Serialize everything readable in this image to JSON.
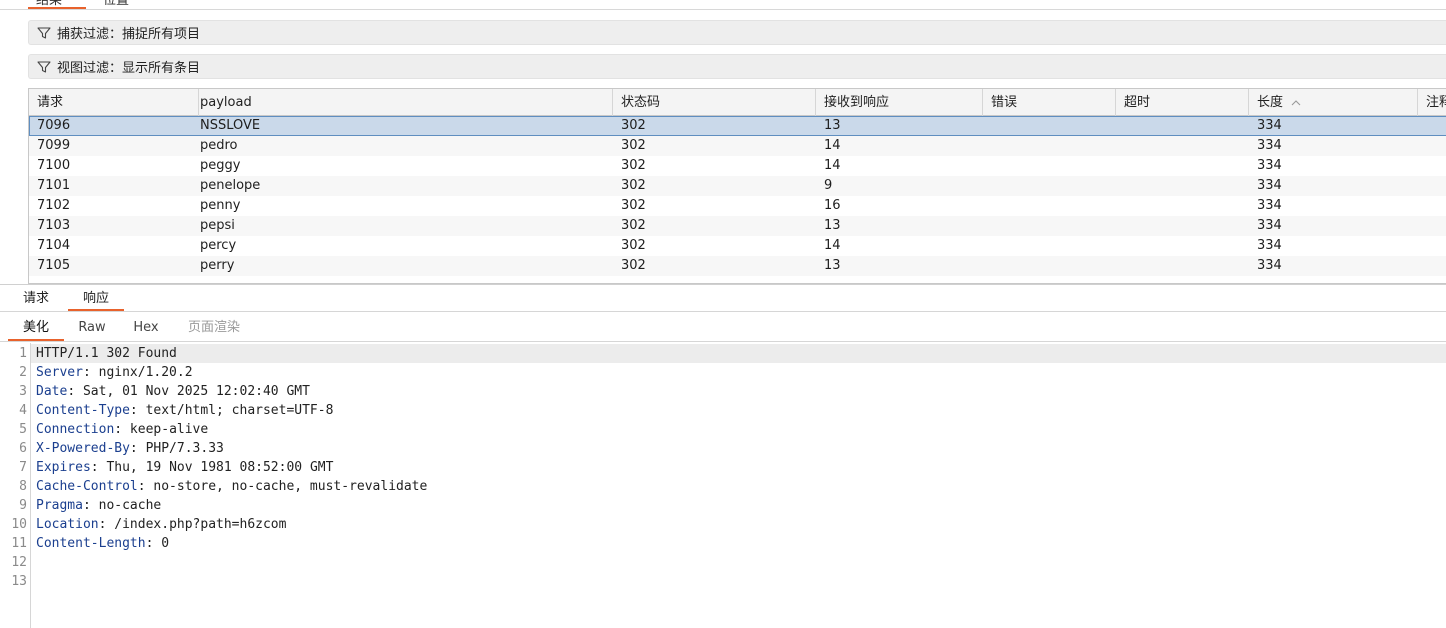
{
  "top_tabs": [
    "结果",
    "位置"
  ],
  "filters": {
    "capture": "捕获过滤：捕捉所有项目",
    "view": "视图过滤：显示所有条目"
  },
  "table": {
    "columns": [
      "请求",
      "payload",
      "状态码",
      "接收到响应",
      "错误",
      "超时",
      "长度",
      "注释"
    ],
    "sort_column": "长度",
    "rows": [
      {
        "req": "7096",
        "payload": "NSSLOVE",
        "status": "302",
        "recv": "13",
        "error": "",
        "timeout": "",
        "length": "334",
        "comment": "",
        "selected": true
      },
      {
        "req": "7099",
        "payload": "pedro",
        "status": "302",
        "recv": "14",
        "error": "",
        "timeout": "",
        "length": "334",
        "comment": ""
      },
      {
        "req": "7100",
        "payload": "peggy",
        "status": "302",
        "recv": "14",
        "error": "",
        "timeout": "",
        "length": "334",
        "comment": ""
      },
      {
        "req": "7101",
        "payload": "penelope",
        "status": "302",
        "recv": "9",
        "error": "",
        "timeout": "",
        "length": "334",
        "comment": ""
      },
      {
        "req": "7102",
        "payload": "penny",
        "status": "302",
        "recv": "16",
        "error": "",
        "timeout": "",
        "length": "334",
        "comment": ""
      },
      {
        "req": "7103",
        "payload": "pepsi",
        "status": "302",
        "recv": "13",
        "error": "",
        "timeout": "",
        "length": "334",
        "comment": ""
      },
      {
        "req": "7104",
        "payload": "percy",
        "status": "302",
        "recv": "14",
        "error": "",
        "timeout": "",
        "length": "334",
        "comment": ""
      },
      {
        "req": "7105",
        "payload": "perry",
        "status": "302",
        "recv": "13",
        "error": "",
        "timeout": "",
        "length": "334",
        "comment": ""
      }
    ]
  },
  "rr_tabs": {
    "request": "请求",
    "response": "响应"
  },
  "view_tabs": [
    "美化",
    "Raw",
    "Hex",
    "页面渲染"
  ],
  "response_lines": [
    {
      "n": "1",
      "name": "",
      "value": "HTTP/1.1 302 Found"
    },
    {
      "n": "2",
      "name": "Server",
      "value": ": nginx/1.20.2"
    },
    {
      "n": "3",
      "name": "Date",
      "value": ": Sat, 01 Nov 2025 12:02:40 GMT"
    },
    {
      "n": "4",
      "name": "Content-Type",
      "value": ": text/html; charset=UTF-8"
    },
    {
      "n": "5",
      "name": "Connection",
      "value": ": keep-alive"
    },
    {
      "n": "6",
      "name": "X-Powered-By",
      "value": ": PHP/7.3.33"
    },
    {
      "n": "7",
      "name": "Expires",
      "value": ": Thu, 19 Nov 1981 08:52:00 GMT"
    },
    {
      "n": "8",
      "name": "Cache-Control",
      "value": ": no-store, no-cache, must-revalidate"
    },
    {
      "n": "9",
      "name": "Pragma",
      "value": ": no-cache"
    },
    {
      "n": "10",
      "name": "Location",
      "value": ": /index.php?path=h6zcom"
    },
    {
      "n": "11",
      "name": "Content-Length",
      "value": ": 0"
    },
    {
      "n": "12",
      "name": "",
      "value": ""
    },
    {
      "n": "13",
      "name": "",
      "value": ""
    }
  ],
  "colors": {
    "accent": "#e8622c",
    "selected_row": "#cad9ea",
    "header_name": "#1b3f8f"
  }
}
